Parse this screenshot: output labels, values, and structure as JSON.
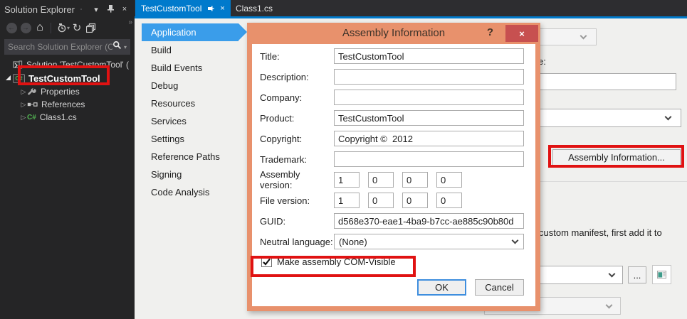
{
  "colors": {
    "accent_blue": "#007ACC",
    "selected_page_blue": "#3A9DEA",
    "dialog_border_salmon": "#E8916C",
    "close_button_red": "#C75050",
    "annotation_red": "#E01212",
    "dark_panel": "#252526"
  },
  "icons": {
    "panel_menu": "▾",
    "panel_close": "×",
    "back": "←",
    "forward": "→",
    "home": "⌂",
    "history_dropdown": "▾",
    "refresh": "↻",
    "overflow": "»",
    "search_dropdown": "▾",
    "expander_collapsed": "▷",
    "tab_close": "×",
    "dialog_close": "×"
  },
  "solution_explorer": {
    "title": "Solution Explorer",
    "search": {
      "placeholder": "Search Solution Explorer (C"
    },
    "tree": {
      "solution": "Solution 'TestCustomTool' (",
      "project": "TestCustomTool",
      "properties": "Properties",
      "references": "References",
      "class1": "Class1.cs"
    }
  },
  "document_tabs": {
    "active": "TestCustomTool",
    "inactive": "Class1.cs"
  },
  "property_pages": {
    "selected": "Application",
    "items": [
      "Application",
      "Build",
      "Build Events",
      "Debug",
      "Resources",
      "Services",
      "Settings",
      "Reference Paths",
      "Signing",
      "Code Analysis"
    ]
  },
  "application_page": {
    "partial_label": "e:",
    "assembly_information_button": "Assembly Information...",
    "manifest_text_partial": "custom manifest, first add it to",
    "browse_button": "..."
  },
  "dialog": {
    "title": "Assembly Information",
    "help": "?",
    "fields": {
      "title": {
        "label": "Title:",
        "value": "TestCustomTool"
      },
      "description": {
        "label": "Description:",
        "value": ""
      },
      "company": {
        "label": "Company:",
        "value": ""
      },
      "product": {
        "label": "Product:",
        "value": "TestCustomTool"
      },
      "copyright": {
        "label": "Copyright:",
        "value": "Copyright ©  2012"
      },
      "trademark": {
        "label": "Trademark:",
        "value": ""
      },
      "assembly_version": {
        "label": "Assembly version:",
        "values": [
          "1",
          "0",
          "0",
          "0"
        ]
      },
      "file_version": {
        "label": "File version:",
        "values": [
          "1",
          "0",
          "0",
          "0"
        ]
      },
      "guid": {
        "label": "GUID:",
        "value": "d568e370-eae1-4ba9-b7cc-ae885c90b80d"
      },
      "neutral_language": {
        "label": "Neutral language:",
        "value": "(None)"
      }
    },
    "com_visible": {
      "label": "Make assembly COM-Visible",
      "checked": true
    },
    "buttons": {
      "ok": "OK",
      "cancel": "Cancel"
    }
  }
}
